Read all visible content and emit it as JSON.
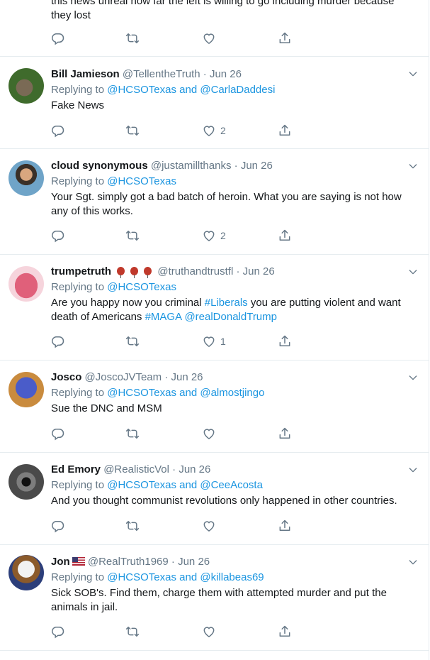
{
  "top_partial": {
    "text_cut": "this news unreal how far the left is willing to go including murder because",
    "text_last": "they lost"
  },
  "tweets": [
    {
      "display_name": "Bill Jamieson",
      "handle": "@TellentheTruth",
      "date": "Jun 26",
      "replying_prefix": "Replying to",
      "mentions": [
        "@HCSOTexas",
        "and",
        "@CarlaDaddesi"
      ],
      "text": "Fake News",
      "likes": "2"
    },
    {
      "display_name": "cloud synonymous",
      "handle": "@justamillthanks",
      "date": "Jun 26",
      "replying_prefix": "Replying to",
      "mentions": [
        "@HCSOTexas"
      ],
      "text_line1": "Your Sgt. simply got a bad batch of heroin. What you are saying is not how",
      "text_line2": "any of this works.",
      "likes": "2"
    },
    {
      "display_name": "trumpetruth",
      "handle": "@truthandtrustfl",
      "date": "Jun 26",
      "replying_prefix": "Replying to",
      "mentions": [
        "@HCSOTexas"
      ],
      "text_a": "Are you happy now you criminal ",
      "tag_liberals": "#Liberals",
      "text_b": " you are putting violent and want",
      "text_c": "death of Americans ",
      "tag_maga": "#MAGA",
      "mention_trump": "@realDonaldTrump",
      "likes": "1"
    },
    {
      "display_name": "Josco",
      "handle": "@JoscoJVTeam",
      "date": "Jun 26",
      "replying_prefix": "Replying to",
      "mentions": [
        "@HCSOTexas",
        "and",
        "@almostjingo"
      ],
      "text": "Sue the DNC and MSM"
    },
    {
      "display_name": "Ed Emory",
      "handle": "@RealisticVol",
      "date": "Jun 26",
      "replying_prefix": "Replying to",
      "mentions": [
        "@HCSOTexas",
        "and",
        "@CeeAcosta"
      ],
      "text": "And you thought communist revolutions only happened in other countries."
    },
    {
      "display_name": "Jon",
      "handle": "@RealTruth1969",
      "date": "Jun 26",
      "replying_prefix": "Replying to",
      "mentions": [
        "@HCSOTexas",
        "and",
        "@killabeas69"
      ],
      "text_line1": "Sick SOB's. Find them, charge them with attempted murder and put the",
      "text_line2": "animals in jail."
    }
  ],
  "colors": {
    "link": "#1b95e0",
    "muted": "#657786",
    "text": "#14171a",
    "divider": "#e6ecf0"
  },
  "icons": [
    "reply-icon",
    "retweet-icon",
    "like-icon",
    "share-icon",
    "chevron-down-icon"
  ]
}
